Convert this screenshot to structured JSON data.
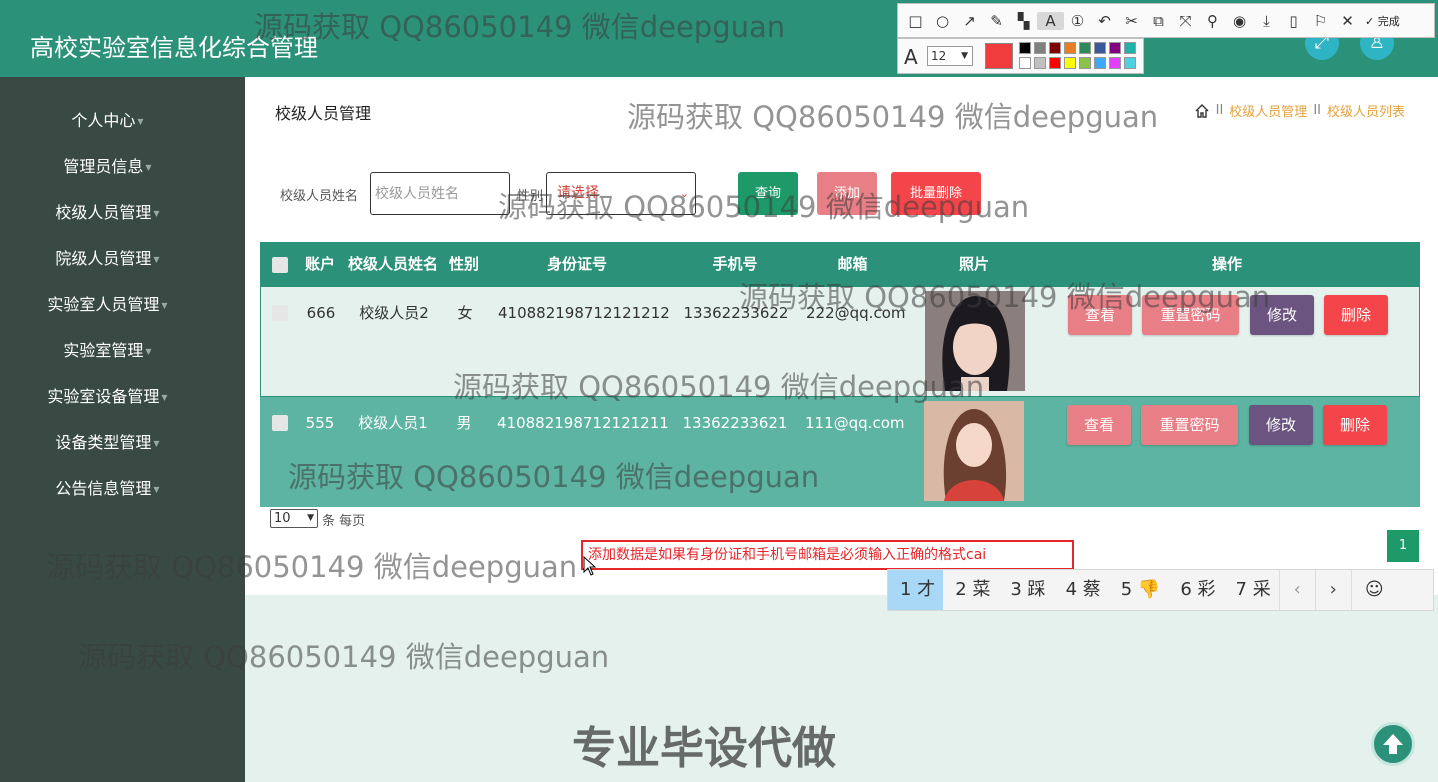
{
  "app": {
    "title": "高校实验室信息化综合管理"
  },
  "sidebar": {
    "items": [
      {
        "label": "个人中心"
      },
      {
        "label": "管理员信息"
      },
      {
        "label": "校级人员管理"
      },
      {
        "label": "院级人员管理"
      },
      {
        "label": "实验室人员管理"
      },
      {
        "label": "实验室管理"
      },
      {
        "label": "实验室设备管理"
      },
      {
        "label": "设备类型管理"
      },
      {
        "label": "公告信息管理"
      }
    ]
  },
  "main": {
    "title": "校级人员管理",
    "breadcrumb": {
      "item1": "校级人员管理",
      "item2": "校级人员列表",
      "sep": "II"
    }
  },
  "search": {
    "name_label": "校级人员姓名",
    "name_placeholder": "校级人员姓名",
    "gender_label": "性别",
    "gender_value": "请选择",
    "query_label": "查询",
    "add_label": "添加",
    "batch_delete_label": "批量删除"
  },
  "table": {
    "headers": {
      "account": "账户",
      "name": "校级人员姓名",
      "gender": "性别",
      "id_card": "身份证号",
      "phone": "手机号",
      "email": "邮箱",
      "photo": "照片",
      "actions": "操作"
    },
    "rows": [
      {
        "account": "666",
        "name": "校级人员2",
        "gender": "女",
        "id_card": "410882198712121212",
        "phone": "13362233622",
        "email": "222@qq.com"
      },
      {
        "account": "555",
        "name": "校级人员1",
        "gender": "男",
        "id_card": "410882198712121211",
        "phone": "13362233621",
        "email": "111@qq.com"
      }
    ],
    "actions": {
      "view": "查看",
      "reset": "重置密码",
      "edit": "修改",
      "delete": "删除"
    }
  },
  "pagination": {
    "page_size": "10",
    "page_size_label": "条 每页",
    "current_page": "1"
  },
  "annotation": {
    "text": "添加数据是如果有身份证和手机号邮箱是必须输入正确的格式cai"
  },
  "ime": {
    "candidates": [
      "1 才",
      "2 菜",
      "3 踩",
      "4 蔡",
      "5 👎",
      "6 彩",
      "7 采"
    ],
    "prev": "‹",
    "next": "›",
    "emoji": "☺"
  },
  "toolbar": {
    "done_label": "✓ 完成",
    "font_size": "12",
    "current_color": "#f03c3c",
    "swatches": [
      "#000000",
      "#808080",
      "#800000",
      "#e67e22",
      "#2e8b57",
      "#3b5998",
      "#800080",
      "#20b2aa",
      "#ffffff",
      "#c0c0c0",
      "#ff0000",
      "#ffff00",
      "#8bc34a",
      "#3fa9f5",
      "#e040fb",
      "#4dd0e1"
    ]
  },
  "watermarks": {
    "text": "源码获取 QQ86050149 微信deepguan",
    "big": "专业毕设代做"
  },
  "colors": {
    "header": "#2c9179",
    "sidebar": "#394a45",
    "btn_red": "#f4464a",
    "btn_pink": "#e97f86",
    "btn_purple": "#6b5580",
    "btn_green": "#1e9a68",
    "accent_gold": "#e3a23b"
  }
}
